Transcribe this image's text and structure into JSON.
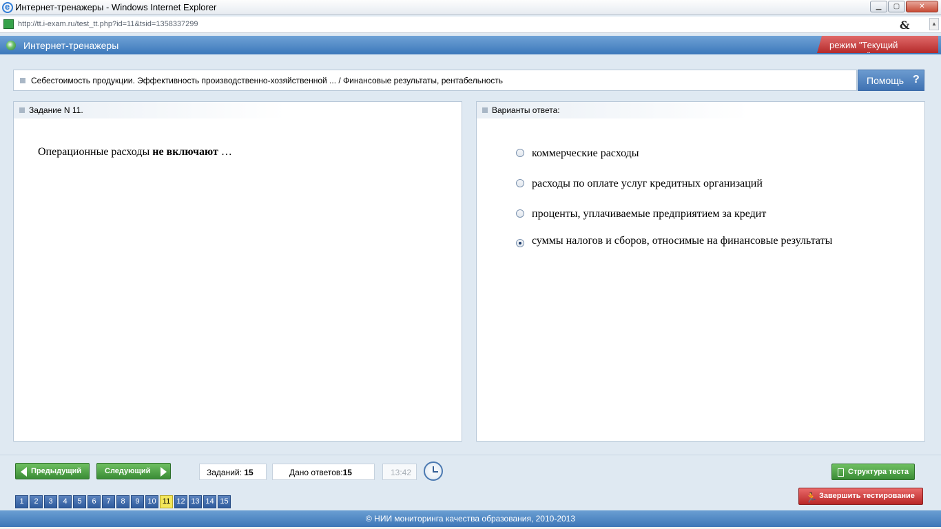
{
  "window": {
    "title": "Интернет-тренажеры - Windows Internet Explorer",
    "url": "http://tt.i-exam.ru/test_tt.php?id=11&tsid=1358337299",
    "min": "▁",
    "max": "▢",
    "close": "✕",
    "compat": "&",
    "scroll_up": "▲"
  },
  "app": {
    "title": "Интернет-тренажеры",
    "mode": "режим \"Текущий контроль\""
  },
  "topic": "Себестоимость продукции. Эффективность производственно-хозяйственной ... / Финансовые результаты, рентабельность",
  "help": {
    "label": "Помощь",
    "icon": "?"
  },
  "task": {
    "header": "Задание N 11.",
    "question_prefix": "Операционные расходы ",
    "question_bold": "не включают",
    "question_suffix": " …"
  },
  "answers": {
    "header": "Варианты ответа:",
    "options": [
      {
        "text": "коммерческие расходы",
        "selected": false
      },
      {
        "text": "расходы по оплате услуг кредитных организаций",
        "selected": false
      },
      {
        "text": "проценты, уплачиваемые предприятием за кредит",
        "selected": false
      },
      {
        "text": "суммы налогов и сборов, относимые на финансовые результаты",
        "selected": true
      }
    ]
  },
  "nav": {
    "prev": "Предыдущий",
    "next": "Следующий",
    "tasks_label": "Заданий: ",
    "tasks_value": "15",
    "answers_label": "Дано ответов:",
    "answers_value": "15",
    "timer": "13:42",
    "structure": "Структура теста",
    "finish": "Завершить тестирование",
    "finish_icon": "🏃",
    "pages": [
      "1",
      "2",
      "3",
      "4",
      "5",
      "6",
      "7",
      "8",
      "9",
      "10",
      "11",
      "12",
      "13",
      "14",
      "15"
    ],
    "current_page": "11"
  },
  "footer": "© НИИ мониторинга качества образования, 2010-2013"
}
